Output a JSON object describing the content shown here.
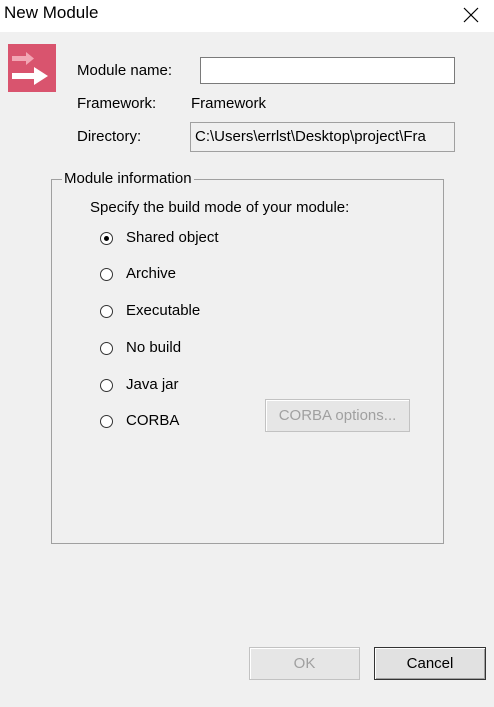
{
  "window": {
    "title": "New Module"
  },
  "icons": {
    "app_icon": "arrow-right-icon",
    "close": "close-icon"
  },
  "form": {
    "module_name_label": "Module name:",
    "module_name_value": "",
    "framework_label": "Framework:",
    "framework_value": "Framework",
    "directory_label": "Directory:",
    "directory_value": "C:\\Users\\errlst\\Desktop\\project\\Fra"
  },
  "module_info": {
    "group_title": "Module information",
    "prompt": "Specify the build mode of your module:",
    "options": [
      {
        "label": "Shared object",
        "checked": true
      },
      {
        "label": "Archive",
        "checked": false
      },
      {
        "label": "Executable",
        "checked": false
      },
      {
        "label": "No build",
        "checked": false
      },
      {
        "label": "Java jar",
        "checked": false
      },
      {
        "label": "CORBA",
        "checked": false
      }
    ],
    "corba_options_label": "CORBA options..."
  },
  "footer": {
    "ok_label": "OK",
    "cancel_label": "Cancel"
  },
  "colors": {
    "dialog_background": "#f0f0f0",
    "titlebar_background": "#ffffff",
    "app_icon_background": "#d9546e",
    "disabled_text": "#a0a0a0"
  }
}
